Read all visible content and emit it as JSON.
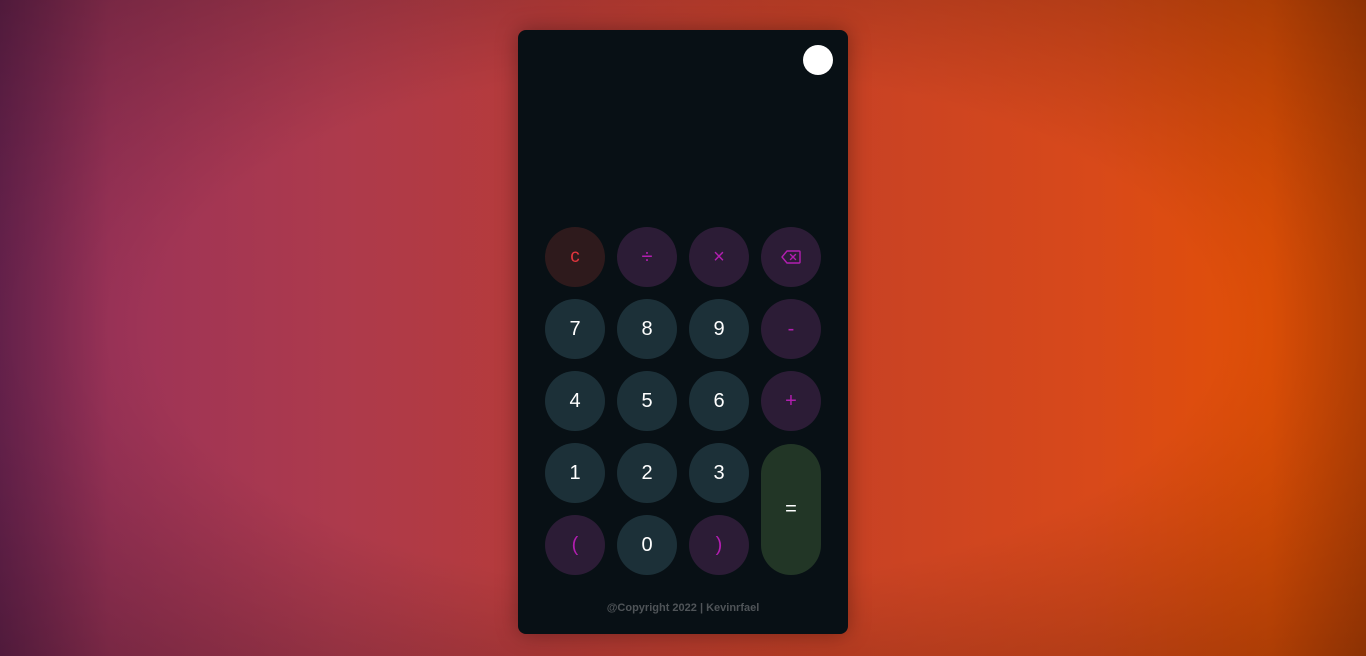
{
  "colors": {
    "calculator_bg": "#081015",
    "number_key_bg": "#1c3038",
    "operator_key_bg": "#2c1c36",
    "operator_text": "#b21eb0",
    "clear_key_bg": "#2e1a1c",
    "clear_text": "#e0353d",
    "equals_key_bg": "#223626"
  },
  "display": {
    "value": ""
  },
  "theme_toggle": {
    "icon": "circle-toggle"
  },
  "keys": {
    "clear": "c",
    "divide": "÷",
    "multiply": "×",
    "backspace_icon": "backspace-icon",
    "seven": "7",
    "eight": "8",
    "nine": "9",
    "minus": "-",
    "four": "4",
    "five": "5",
    "six": "6",
    "plus": "+",
    "one": "1",
    "two": "2",
    "three": "3",
    "equals": "=",
    "open_paren": "(",
    "zero": "0",
    "close_paren": ")"
  },
  "footer": {
    "copyright": "@Copyright 2022 | Kevinrfael"
  }
}
